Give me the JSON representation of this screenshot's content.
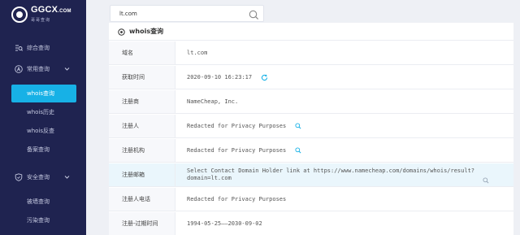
{
  "logo": {
    "name": "GGCX",
    "domain_suffix": ".COM",
    "subtitle": "哥哥查询"
  },
  "search": {
    "value": "lt.com"
  },
  "sidebar": {
    "overview": "综合查询",
    "common": "常用查询",
    "whois_query": "whois查询",
    "whois_history": "whois历史",
    "whois_reverse": "whois反查",
    "icp": "备案查询",
    "security": "安全查询",
    "blocked": "被墙查询",
    "polluted": "污染查询"
  },
  "panel": {
    "title": "whois查询"
  },
  "rows": [
    {
      "label": "域名",
      "value": "lt.com"
    },
    {
      "label": "获取时间",
      "value": "2020-09-10 16:23:17"
    },
    {
      "label": "注册商",
      "value": "NameCheap, Inc."
    },
    {
      "label": "注册人",
      "value": "Redacted for Privacy Purposes"
    },
    {
      "label": "注册机构",
      "value": "Redacted for Privacy Purposes"
    },
    {
      "label": "注册邮箱",
      "value_line1": "Select Contact Domain Holder link at https://www.namecheap.com/domains/whois/result?",
      "value_line2": "domain=lt.com"
    },
    {
      "label": "注册人电话",
      "value": "Redacted for Privacy Purposes"
    },
    {
      "label": "注册-过期时间",
      "value": "1994-05-25——2030-09-02"
    }
  ],
  "colors": {
    "sidebar_bg": "#1f2350",
    "accent": "#17b1e6",
    "highlight_row": "#eaf6fc"
  }
}
